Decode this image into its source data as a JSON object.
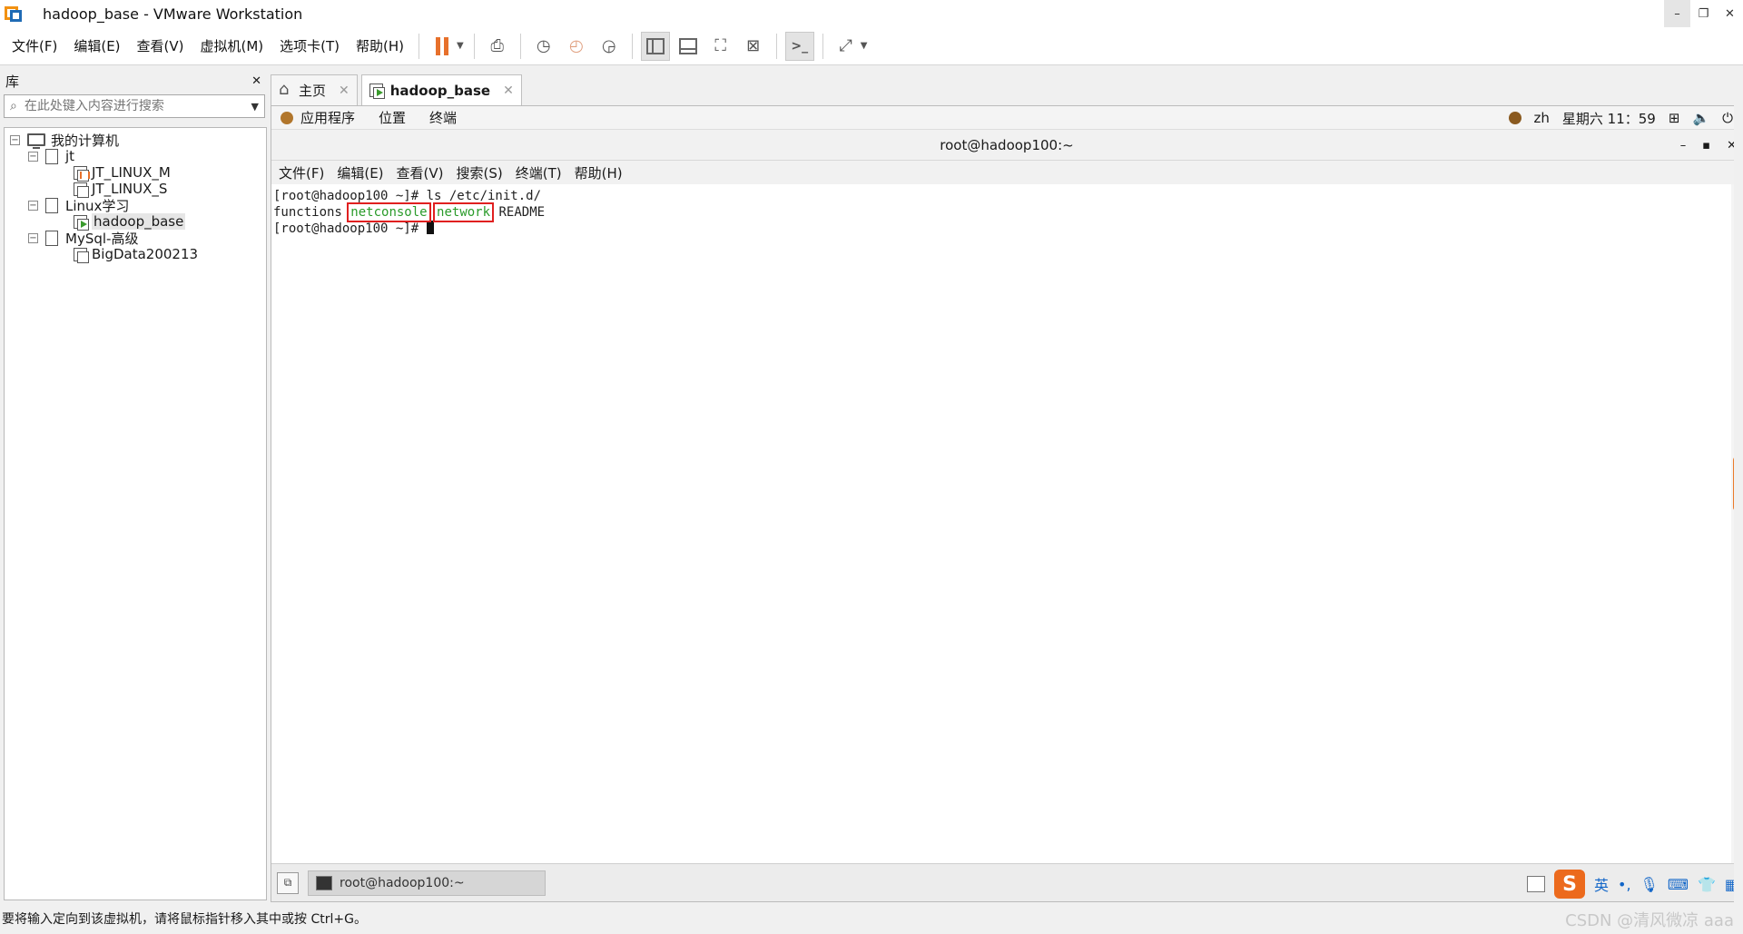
{
  "window": {
    "title": "hadoop_base - VMware Workstation",
    "minimize": "–",
    "restore": "❐",
    "close": "✕"
  },
  "menu": {
    "items": [
      "文件(F)",
      "编辑(E)",
      "查看(V)",
      "虚拟机(M)",
      "选项卡(T)",
      "帮助(H)"
    ]
  },
  "library": {
    "title": "库",
    "close": "✕",
    "search_placeholder": "在此处键入内容进行搜索",
    "tree": {
      "root": "我的计算机",
      "group_jt": "jt",
      "jt_linux_m": "JT_LINUX_M",
      "jt_linux_s": "JT_LINUX_S",
      "group_linux": "Linux学习",
      "hadoop_base": "hadoop_base",
      "group_mysql": "MySql-高级",
      "bigdata": "BigData200213"
    }
  },
  "tabs": {
    "home": "主页",
    "active": "hadoop_base",
    "close": "✕"
  },
  "gnome": {
    "apps": "应用程序",
    "places": "位置",
    "terminal": "终端",
    "lang": "zh",
    "clock": "星期六 11：59"
  },
  "terminal": {
    "title": "root@hadoop100:~",
    "menu": [
      "文件(F)",
      "编辑(E)",
      "查看(V)",
      "搜索(S)",
      "终端(T)",
      "帮助(H)"
    ],
    "line1": "[root@hadoop100 ~]# ls /etc/init.d/",
    "line2_a": "functions ",
    "line2_netconsole": "netconsole",
    "line2_network": "network",
    "line2_readme": " README",
    "line3": "[root@hadoop100 ~]# "
  },
  "taskbar": {
    "item": "root@hadoop100:~",
    "ime": "英"
  },
  "statusbar": {
    "text": "要将输入定向到该虚拟机，请将鼠标指针移入其中或按 Ctrl+G。"
  },
  "watermark": "CSDN @清风微凉 aaa",
  "colors": {
    "accent_orange": "#e7702b",
    "terminal_green": "#2a9b2a",
    "highlight_red": "#e02020"
  }
}
